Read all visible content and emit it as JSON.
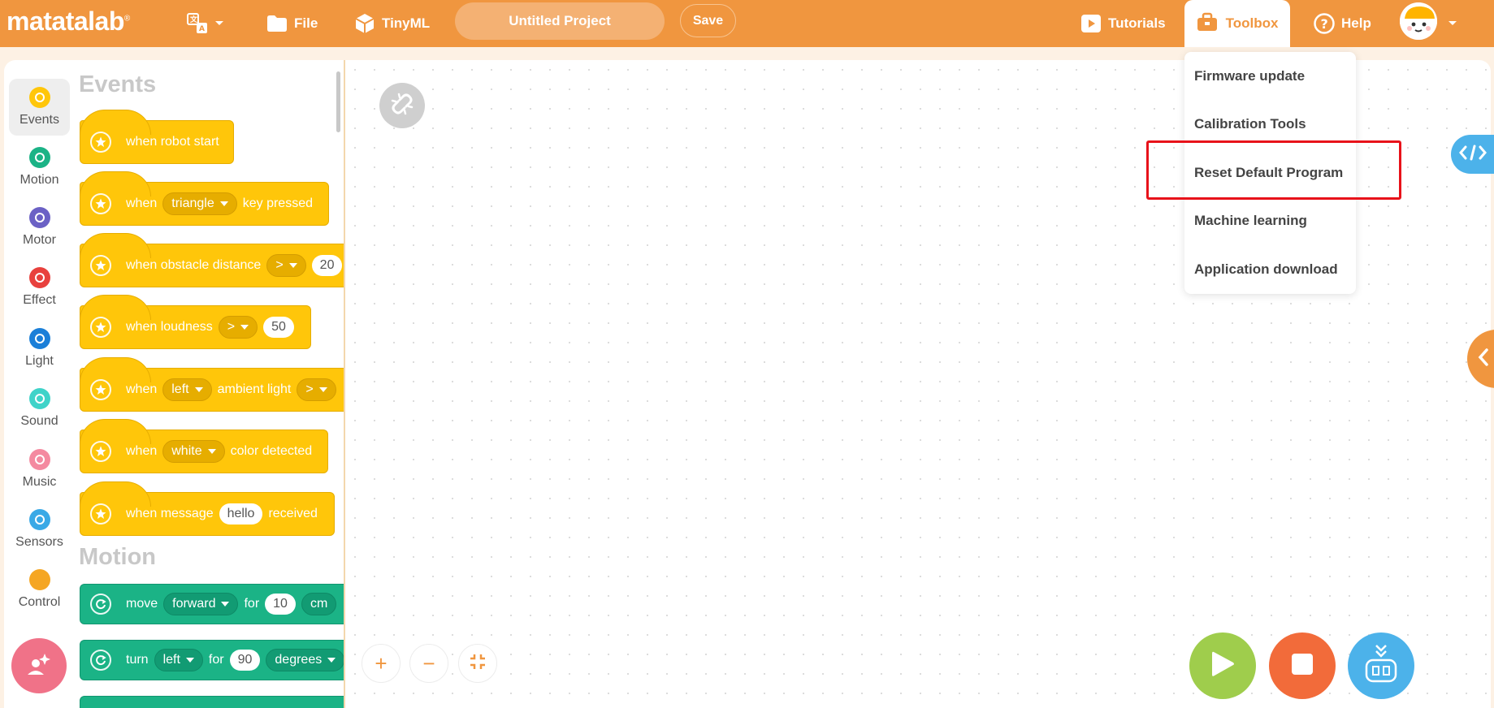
{
  "header": {
    "logo": "matatalab",
    "logo_mark": "®",
    "file_label": "File",
    "tinyml_label": "TinyML",
    "project_name": "Untitled Project",
    "save_label": "Save",
    "tutorials_label": "Tutorials",
    "toolbox_label": "Toolbox",
    "help_label": "Help"
  },
  "colors": {
    "brand_orange": "#f0963f",
    "events_yellow": "#ffc60a",
    "motion_green": "#1bb386",
    "highlight_red": "#e8121a"
  },
  "categories": [
    {
      "label": "Events",
      "color": "#ffc60a",
      "active": true
    },
    {
      "label": "Motion",
      "color": "#1bb386"
    },
    {
      "label": "Motor",
      "color": "#6b61c5"
    },
    {
      "label": "Effect",
      "color": "#e8413d"
    },
    {
      "label": "Light",
      "color": "#1b7fd8"
    },
    {
      "label": "Sound",
      "color": "#3fd3c9"
    },
    {
      "label": "Music",
      "color": "#f48aa0"
    },
    {
      "label": "Sensors",
      "color": "#3aa9e6"
    },
    {
      "label": "Control",
      "color": "#f5a623"
    }
  ],
  "palette": {
    "events_title": "Events",
    "motion_title": "Motion",
    "blocks": {
      "robot_start": "when robot start",
      "key_when": "when",
      "key_option": "triangle",
      "key_suffix": "key pressed",
      "obstacle_prefix": "when obstacle distance",
      "obstacle_op": ">",
      "obstacle_value": "20",
      "loud_prefix": "when loudness",
      "loud_op": ">",
      "loud_value": "50",
      "light_when": "when",
      "light_side": "left",
      "light_mid": "ambient light",
      "light_op": ">",
      "color_when": "when",
      "color_option": "white",
      "color_suffix": "color detected",
      "msg_prefix": "when message",
      "msg_value": "hello",
      "msg_suffix": "received",
      "move_prefix": "move",
      "move_dir": "forward",
      "move_for": "for",
      "move_value": "10",
      "move_unit": "cm",
      "turn_prefix": "turn",
      "turn_dir": "left",
      "turn_for": "for",
      "turn_value": "90",
      "turn_unit": "degrees"
    }
  },
  "toolbox_menu": {
    "items": [
      "Firmware update",
      "Calibration Tools",
      "Reset Default Program",
      "Machine learning",
      "Application download"
    ]
  },
  "workspace": {
    "zoom_in": "+",
    "zoom_out": "−"
  }
}
